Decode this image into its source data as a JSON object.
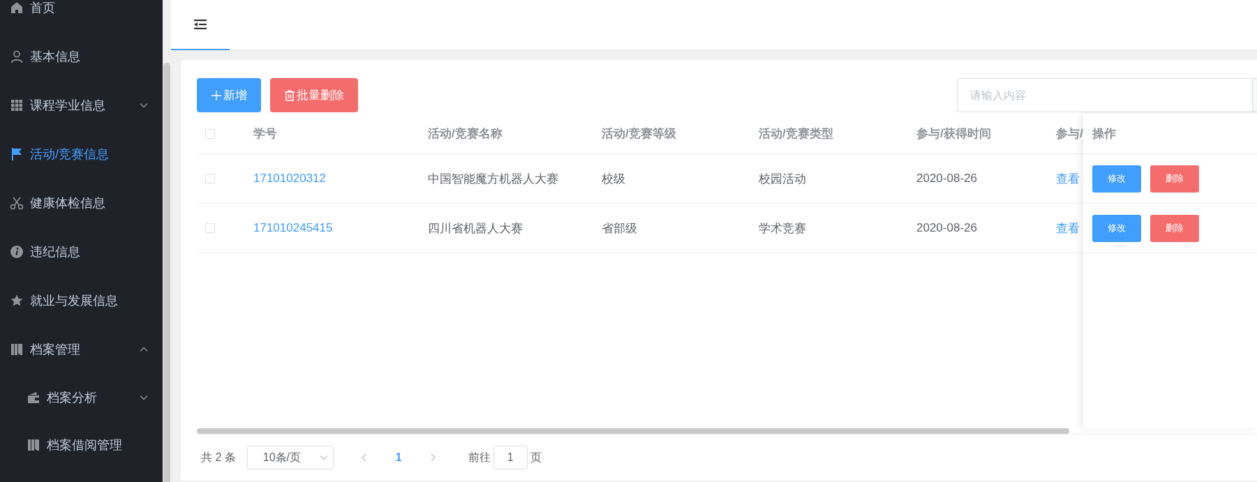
{
  "sidebar": {
    "items": [
      {
        "label": "首页",
        "selected": false
      },
      {
        "label": "基本信息",
        "selected": false
      },
      {
        "label": "课程学业信息",
        "selected": false,
        "expanded": false
      },
      {
        "label": "活动/竞赛信息",
        "selected": true
      },
      {
        "label": "健康体检信息",
        "selected": false
      },
      {
        "label": "违纪信息",
        "selected": false
      },
      {
        "label": "就业与发展信息",
        "selected": false
      },
      {
        "label": "档案管理",
        "selected": false,
        "expanded": true,
        "children": [
          {
            "label": "档案分析",
            "selected": false,
            "expanded": false
          },
          {
            "label": "档案借阅管理",
            "selected": false
          }
        ]
      }
    ]
  },
  "header": {
    "tabs": [
      {
        "selected": true
      }
    ]
  },
  "toolbar": {
    "buttons": [
      {
        "label": "新增",
        "kind": "primary"
      },
      {
        "label": "批量删除",
        "kind": "danger"
      }
    ],
    "search": {
      "placeholder": "请输入内容"
    }
  },
  "table": {
    "header_checked": false,
    "columns": [
      "学号",
      "活动/竞赛名称",
      "活动/竞赛等级",
      "活动/竞赛类型",
      "参与/获得时间",
      "参与/"
    ],
    "actions_column": "操作",
    "rows": [
      {
        "checked": false,
        "cells": [
          "17101020312",
          "中国智能魔方机器人大赛",
          "校级",
          "校园活动",
          "2020-08-26",
          "查看"
        ],
        "actions": [
          {
            "label": "修改",
            "kind": "primary"
          },
          {
            "label": "删除",
            "kind": "danger"
          }
        ]
      },
      {
        "checked": false,
        "cells": [
          "171010245415",
          "四川省机器人大赛",
          "省部级",
          "学术竞赛",
          "2020-08-26",
          "查看"
        ],
        "actions": [
          {
            "label": "修改",
            "kind": "primary"
          },
          {
            "label": "删除",
            "kind": "danger"
          }
        ]
      }
    ]
  },
  "pagination": {
    "total": "共 2 条",
    "page_size": "10条/页",
    "pages": [
      {
        "label": "1",
        "selected": true
      }
    ],
    "goto_label": "前往",
    "goto_value": "1",
    "goto_suffix": "页"
  }
}
